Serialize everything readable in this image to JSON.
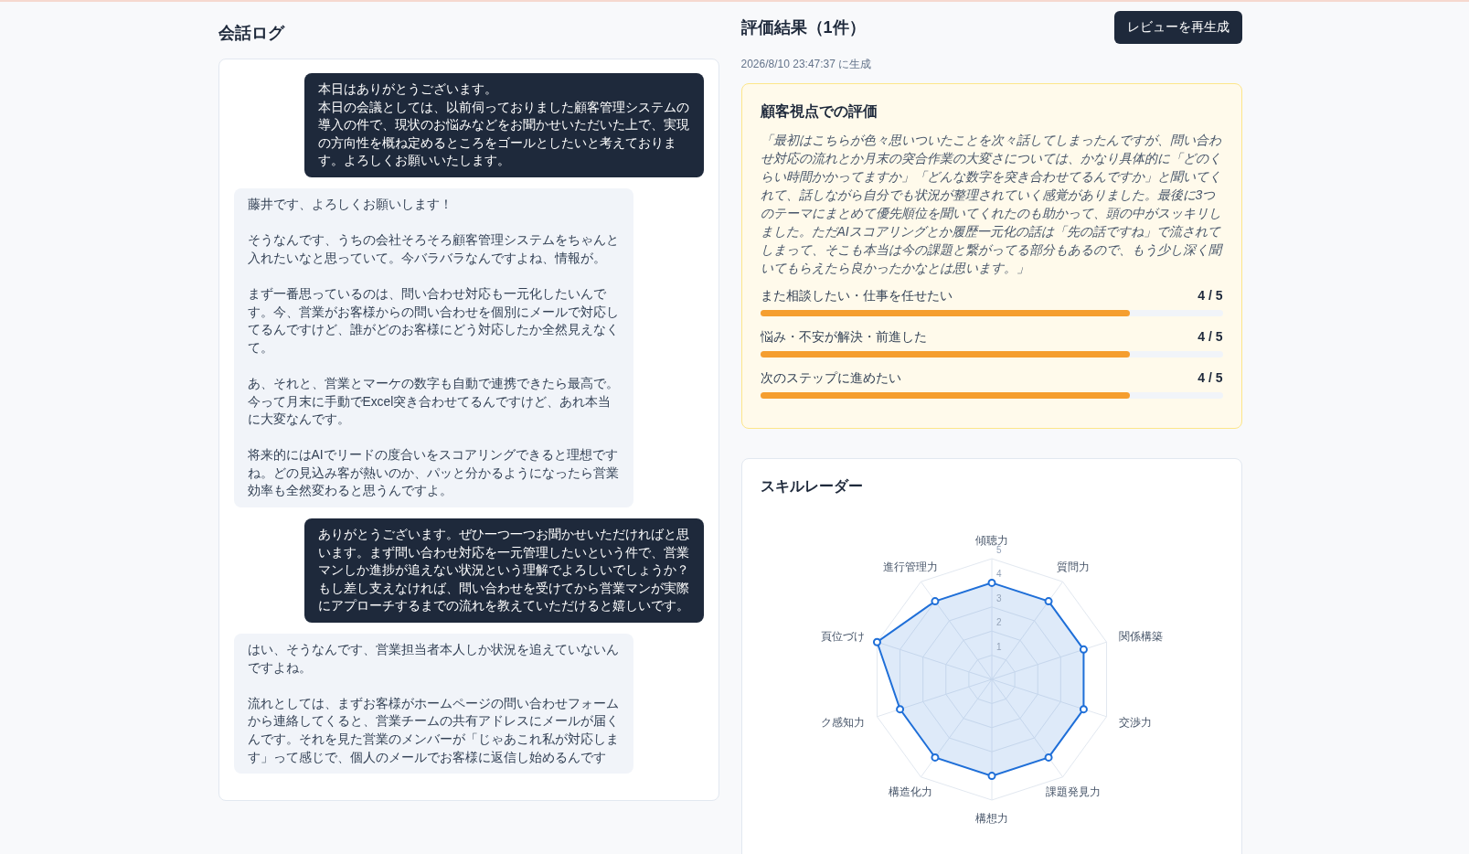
{
  "conversation": {
    "title": "会話ログ",
    "messages": [
      {
        "kind": "sent",
        "paragraphs": [
          "本日はありがとうございます。",
          "本日の会議としては、以前伺っておりました顧客管理システムの導入の件で、現状のお悩みなどをお聞かせいただいた上で、実現の方向性を概ね定めるところをゴールとしたいと考えております。よろしくお願いいたします。"
        ]
      },
      {
        "kind": "received",
        "paragraphs": [
          "藤井です、よろしくお願いします！",
          "そうなんです、うちの会社そろそろ顧客管理システムをちゃんと入れたいなと思っていて。今バラバラなんですよね、情報が。",
          "まず一番思っているのは、問い合わせ対応も一元化したいんです。今、営業がお客様からの問い合わせを個別にメールで対応してるんですけど、誰がどのお客様にどう対応したか全然見えなくて。",
          "あ、それと、営業とマーケの数字も自動で連携できたら最高で。今って月末に手動でExcel突き合わせてるんですけど、あれ本当に大変なんです。",
          "将来的にはAIでリードの度合いをスコアリングできると理想ですね。どの見込み客が熱いのか、パッと分かるようになったら営業効率も全然変わると思うんですよ。"
        ]
      },
      {
        "kind": "sent",
        "paragraphs": [
          "ありがとうございます。ぜひ一つ一つお聞かせいただければと思います。まず問い合わせ対応を一元管理したいという件で、営業マンしか進捗が追えない状況という理解でよろしいでしょうか？もし差し支えなければ、問い合わせを受けてから営業マンが実際にアプローチするまでの流れを教えていただけると嬉しいです。"
        ]
      },
      {
        "kind": "received",
        "paragraphs": [
          "はい、そうなんです、営業担当者本人しか状況を追えていないんですよね。",
          "流れとしては、まずお客様がホームページの問い合わせフォームから連絡してくると、営業チームの共有アドレスにメールが届くんです。それを見た営業のメンバーが「じゃあこれ私が対応します」って感じで、個人のメールでお客様に返信し始めるんです"
        ]
      }
    ]
  },
  "evaluation": {
    "title": "評価結果（1件）",
    "regenerate_button": "レビューを再生成",
    "generated_at": "2026/8/10 23:47:37 に生成",
    "customer_view": {
      "title": "顧客視点での評価",
      "quote": "「最初はこちらが色々思いついたことを次々話してしまったんですが、問い合わせ対応の流れとか月末の突合作業の大変さについては、かなり具体的に「どのくらい時間かかってますか」「どんな数字を突き合わせてるんですか」と聞いてくれて、話しながら自分でも状況が整理されていく感覚がありました。最後に3つのテーマにまとめて優先順位を聞いてくれたのも助かって、頭の中がスッキリしました。ただAIスコアリングとか履歴一元化の話は「先の話ですね」で流されてしまって、そこも本当は今の課題と繋がってる部分もあるので、もう少し深く聞いてもらえたら良かったかなとは思います。」",
      "scores": [
        {
          "label": "また相談したい・仕事を任せたい",
          "score": "4 / 5",
          "level": 0.8
        },
        {
          "label": "悩み・不安が解決・前進した",
          "score": "4 / 5",
          "level": 0.8
        },
        {
          "label": "次のステップに進めたい",
          "score": "4 / 5",
          "level": 0.8
        }
      ]
    },
    "skill_radar": {
      "title": "スキルレーダー",
      "chart_data": {
        "type": "radar",
        "categories": [
          "傾聴力",
          "質問力",
          "関係構築",
          "交渉力",
          "課題発見力",
          "構想力",
          "構造化力",
          "ク感知力",
          "頁位づけ",
          "進行管理力"
        ],
        "ylim": [
          0,
          5
        ],
        "yticks": [
          1,
          2,
          3,
          4,
          5
        ],
        "series": [
          {
            "color": "#1f6fd8",
            "values": [
              4,
              4,
              4,
              4,
              4,
              4,
              4,
              4,
              5,
              4
            ]
          }
        ]
      }
    }
  }
}
